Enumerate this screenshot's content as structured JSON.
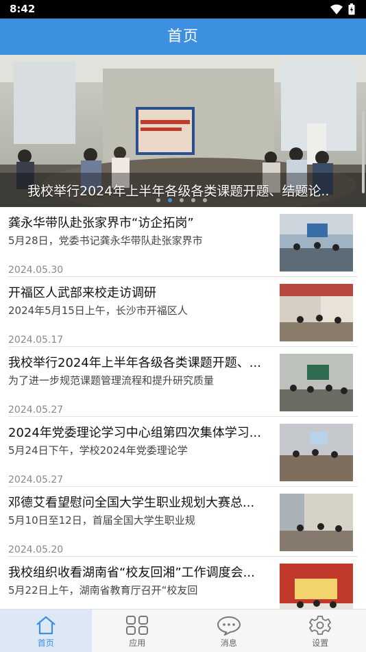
{
  "status_bar": {
    "time": "8:42",
    "icons": [
      "wifi-icon",
      "battery-icon"
    ]
  },
  "app_bar": {
    "title": "首页"
  },
  "banner": {
    "caption": "我校举行2024年上半年各级各类课题开题、结题论..",
    "slide_count": 5,
    "active_slide": 1
  },
  "news": [
    {
      "title": "龚永华带队赴张家界市“访企拓岗”",
      "desc": "5月28日，党委书记龚永华带队赴张家界市",
      "date": "2024.05.30"
    },
    {
      "title": "开福区人武部来校走访调研",
      "desc": "2024年5月15日上午，长沙市开福区人",
      "date": "2024.05.17"
    },
    {
      "title": "我校举行2024年上半年各级各类课题开题、...",
      "desc": "为了进一步规范课题管理流程和提升研究质量",
      "date": "2024.05.27"
    },
    {
      "title": "2024年党委理论学习中心组第四次集体学习...",
      "desc": "5月24日下午，学校2024年党委理论学",
      "date": "2024.05.27"
    },
    {
      "title": "邓德艾看望慰问全国大学生职业规划大赛总...",
      "desc": "5月10日至12日，首届全国大学生职业规",
      "date": "2024.05.20"
    },
    {
      "title": "我校组织收看湖南省“校友回湘”工作调度会...",
      "desc": "5月22日上午，湖南省教育厅召开“校友回",
      "date": ""
    }
  ],
  "tabs": [
    {
      "label": "首页",
      "icon": "home-icon",
      "active": true
    },
    {
      "label": "应用",
      "icon": "grid-icon",
      "active": false
    },
    {
      "label": "消息",
      "icon": "chat-icon",
      "active": false
    },
    {
      "label": "设置",
      "icon": "gear-icon",
      "active": false
    }
  ],
  "colors": {
    "primary": "#3d8fe0",
    "tab_active_bg": "#dce8f5"
  }
}
